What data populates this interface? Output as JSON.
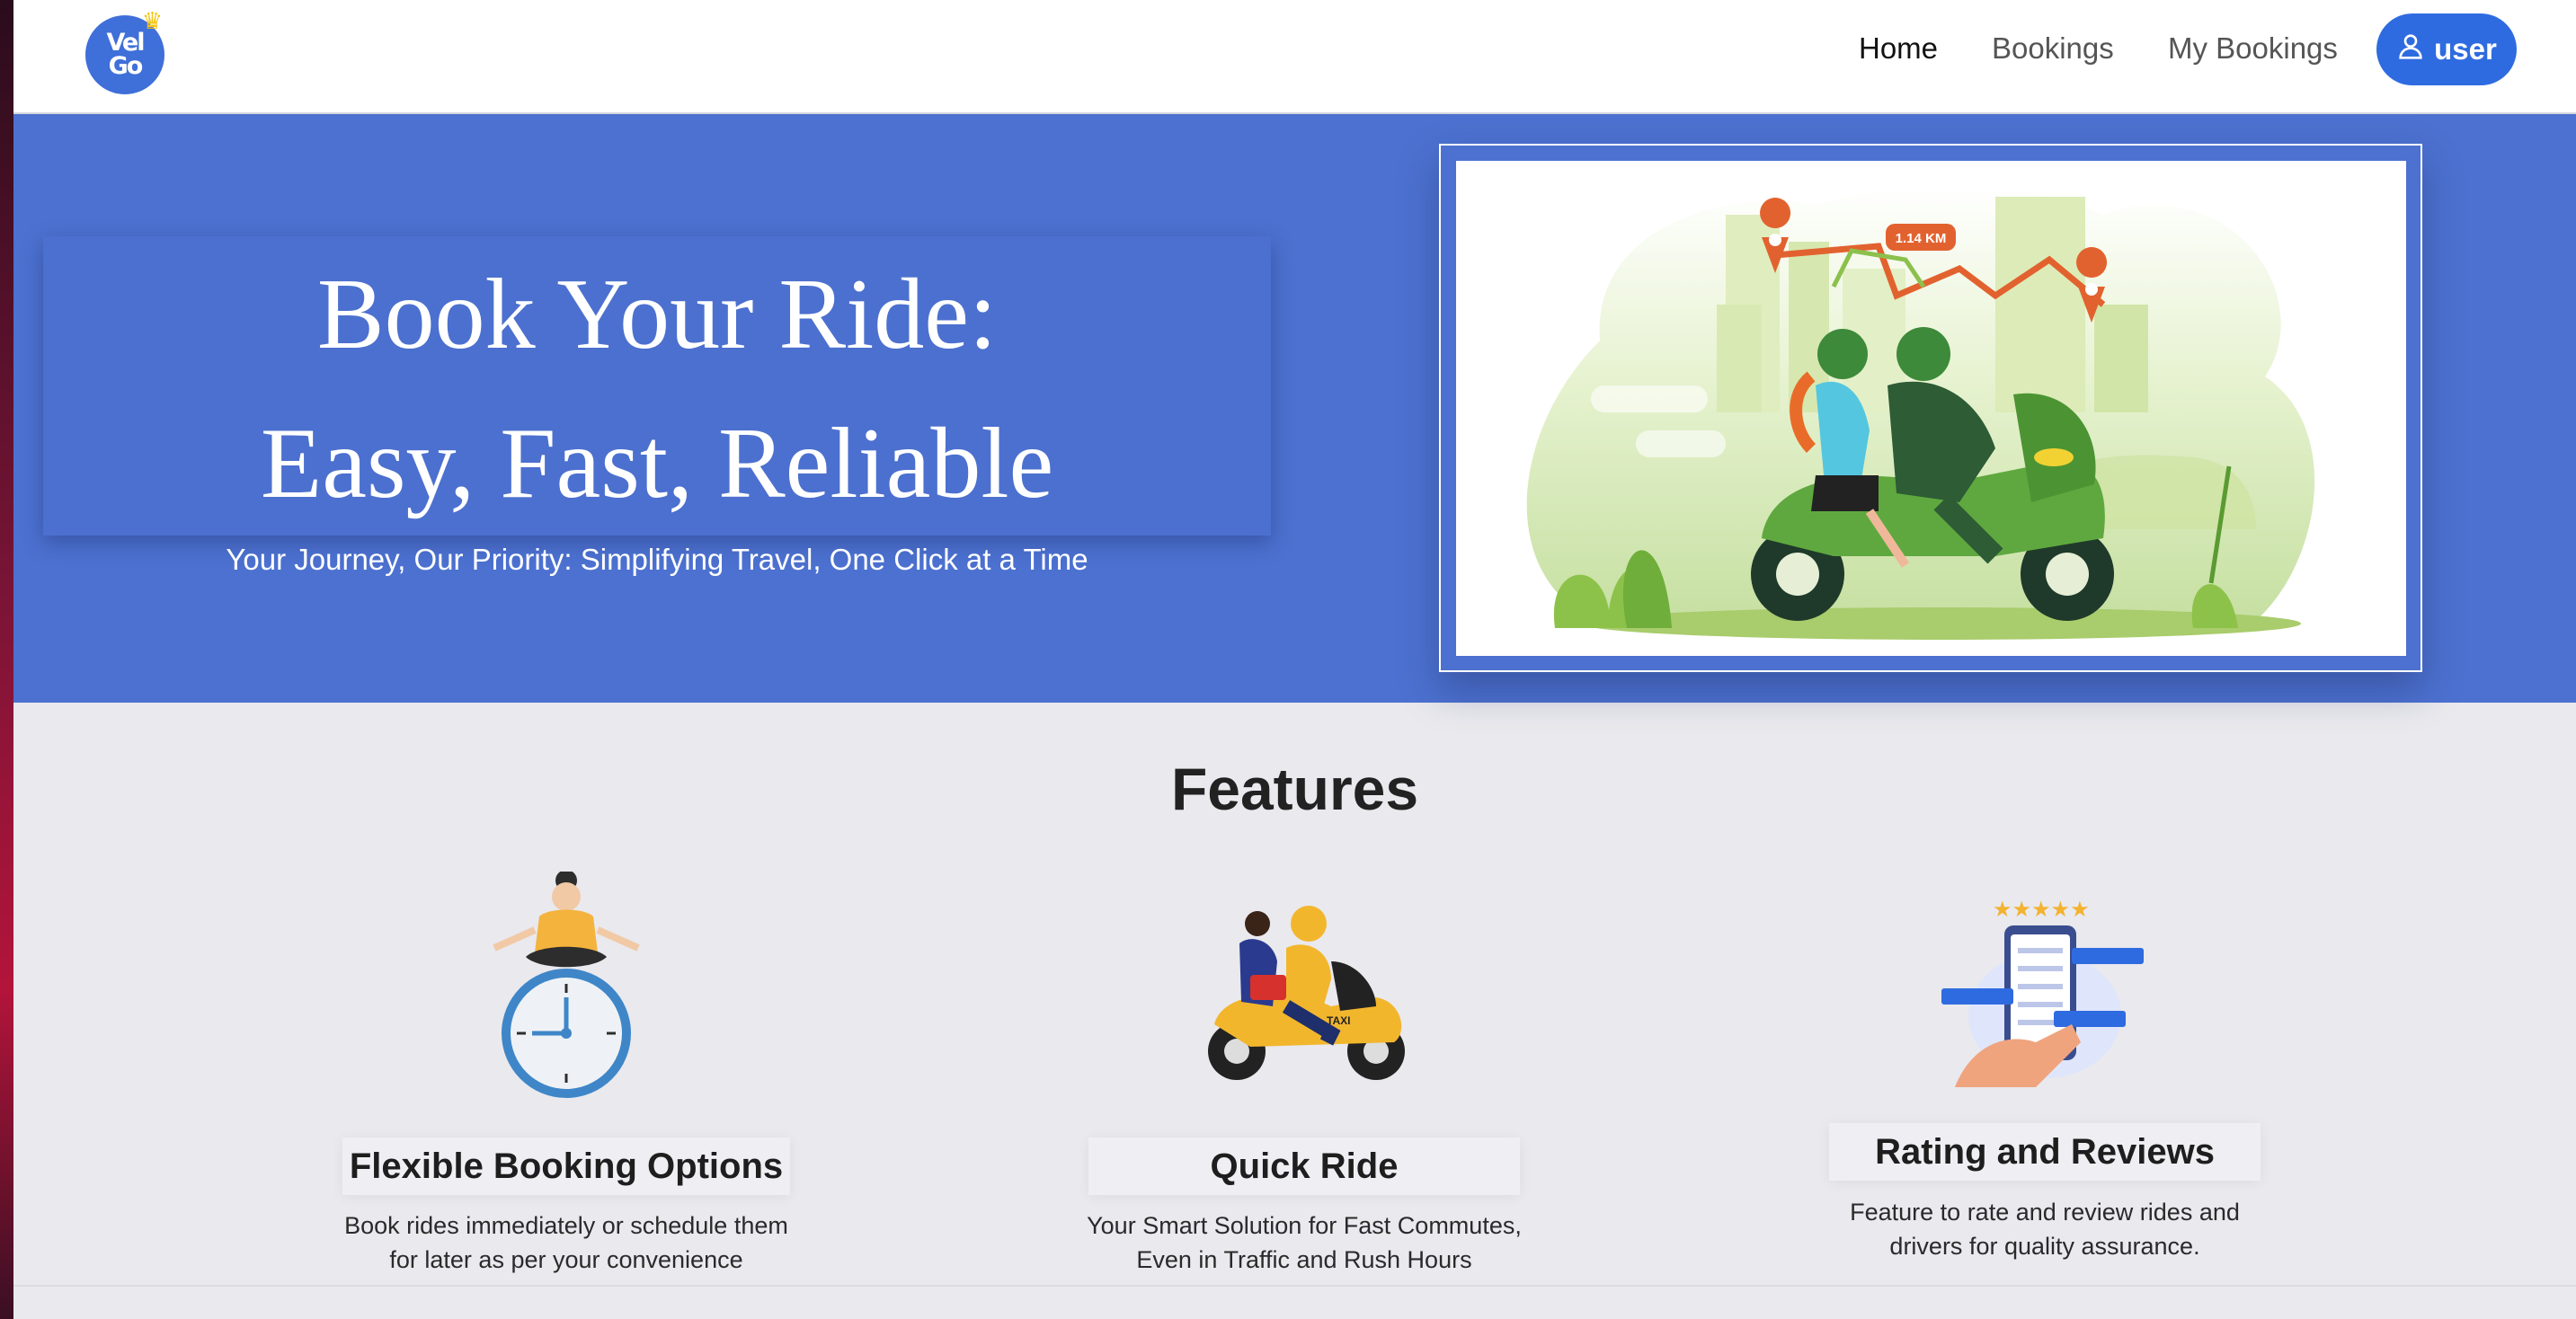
{
  "nav": {
    "logo_text_top": "Vel",
    "logo_text_bottom": "Go",
    "links": [
      "Home",
      "Bookings",
      "My Bookings"
    ],
    "active_link": "Home",
    "user_label": "user"
  },
  "hero": {
    "title_line1": "Book Your Ride:",
    "title_line2": "Easy, Fast, Reliable",
    "subtitle": "Your Journey, Our Priority: Simplifying Travel, One Click at a Time",
    "map_badge": "1.14 KM"
  },
  "features": {
    "title": "Features",
    "items": [
      {
        "title": "Flexible Booking Options",
        "desc_line1": "Book rides immediately or schedule them",
        "desc_line2": "for later as per your convenience",
        "icon": "clock-meditation-icon"
      },
      {
        "title": "Quick Ride",
        "desc_line1": "Your Smart Solution for Fast Commutes,",
        "desc_line2": "Even in Traffic and Rush Hours",
        "icon": "taxi-scooter-icon"
      },
      {
        "title": "Rating and Reviews",
        "desc_line1": "Feature to rate and review rides and",
        "desc_line2": "drivers for quality assurance.",
        "icon": "phone-reviews-icon"
      }
    ]
  },
  "colors": {
    "hero_bg": "#4c71d0",
    "accent": "#2f6be0",
    "page_bg": "#e9e9ee"
  }
}
